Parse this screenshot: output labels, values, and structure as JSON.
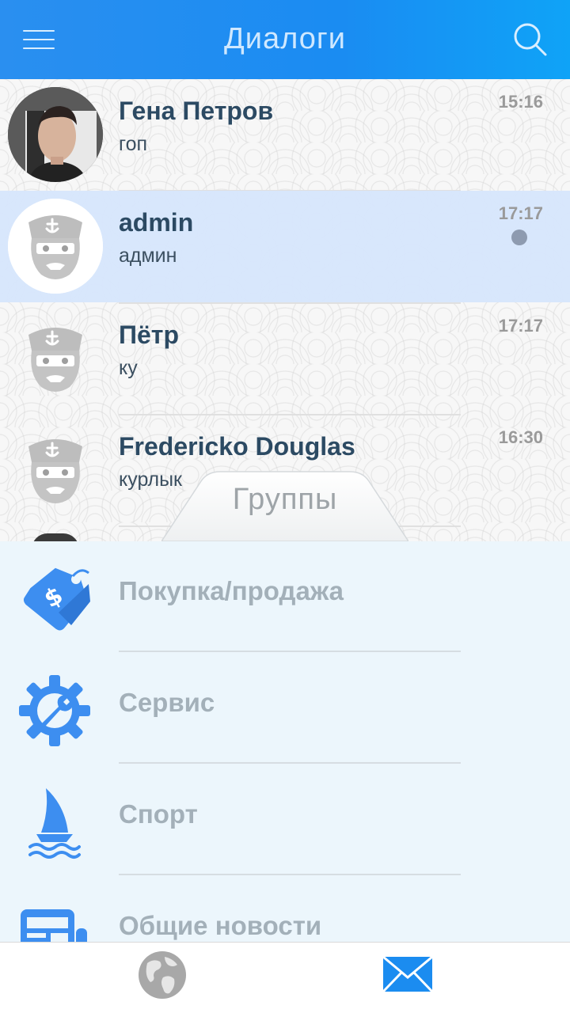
{
  "header": {
    "title": "Диалоги",
    "menu_icon": "hamburger-menu-icon",
    "search_icon": "search-icon"
  },
  "dialogs": [
    {
      "name": "Гена Петров",
      "message": "гоп",
      "time": "15:16",
      "avatar": "photo",
      "active": false,
      "unread": false
    },
    {
      "name": "admin",
      "message": "админ",
      "time": "17:17",
      "avatar": "sailor-avatar-icon",
      "active": true,
      "unread": true
    },
    {
      "name": "Пётр",
      "message": "ку",
      "time": "17:17",
      "avatar": "sailor-avatar-icon",
      "active": false,
      "unread": false
    },
    {
      "name": "Fredericko Douglas",
      "message": "курлык",
      "time": "16:30",
      "avatar": "sailor-avatar-icon",
      "active": false,
      "unread": false
    }
  ],
  "groups_tab": {
    "label": "Группы"
  },
  "groups": [
    {
      "label": "Покупка/продажа",
      "icon": "price-tag-icon"
    },
    {
      "label": "Сервис",
      "icon": "wrench-gear-icon"
    },
    {
      "label": "Спорт",
      "icon": "sailboat-icon"
    },
    {
      "label": "Общие новости",
      "icon": "newspaper-icon"
    }
  ],
  "bottom_nav": {
    "items": [
      {
        "icon": "globe-icon",
        "active": false
      },
      {
        "icon": "mail-icon",
        "active": true
      }
    ]
  },
  "colors": {
    "header_blue": "#1a8cf2",
    "active_row": "#d6e6fc",
    "group_icon_blue": "#3d8ef0",
    "groups_panel_bg": "#ecf6fc"
  }
}
